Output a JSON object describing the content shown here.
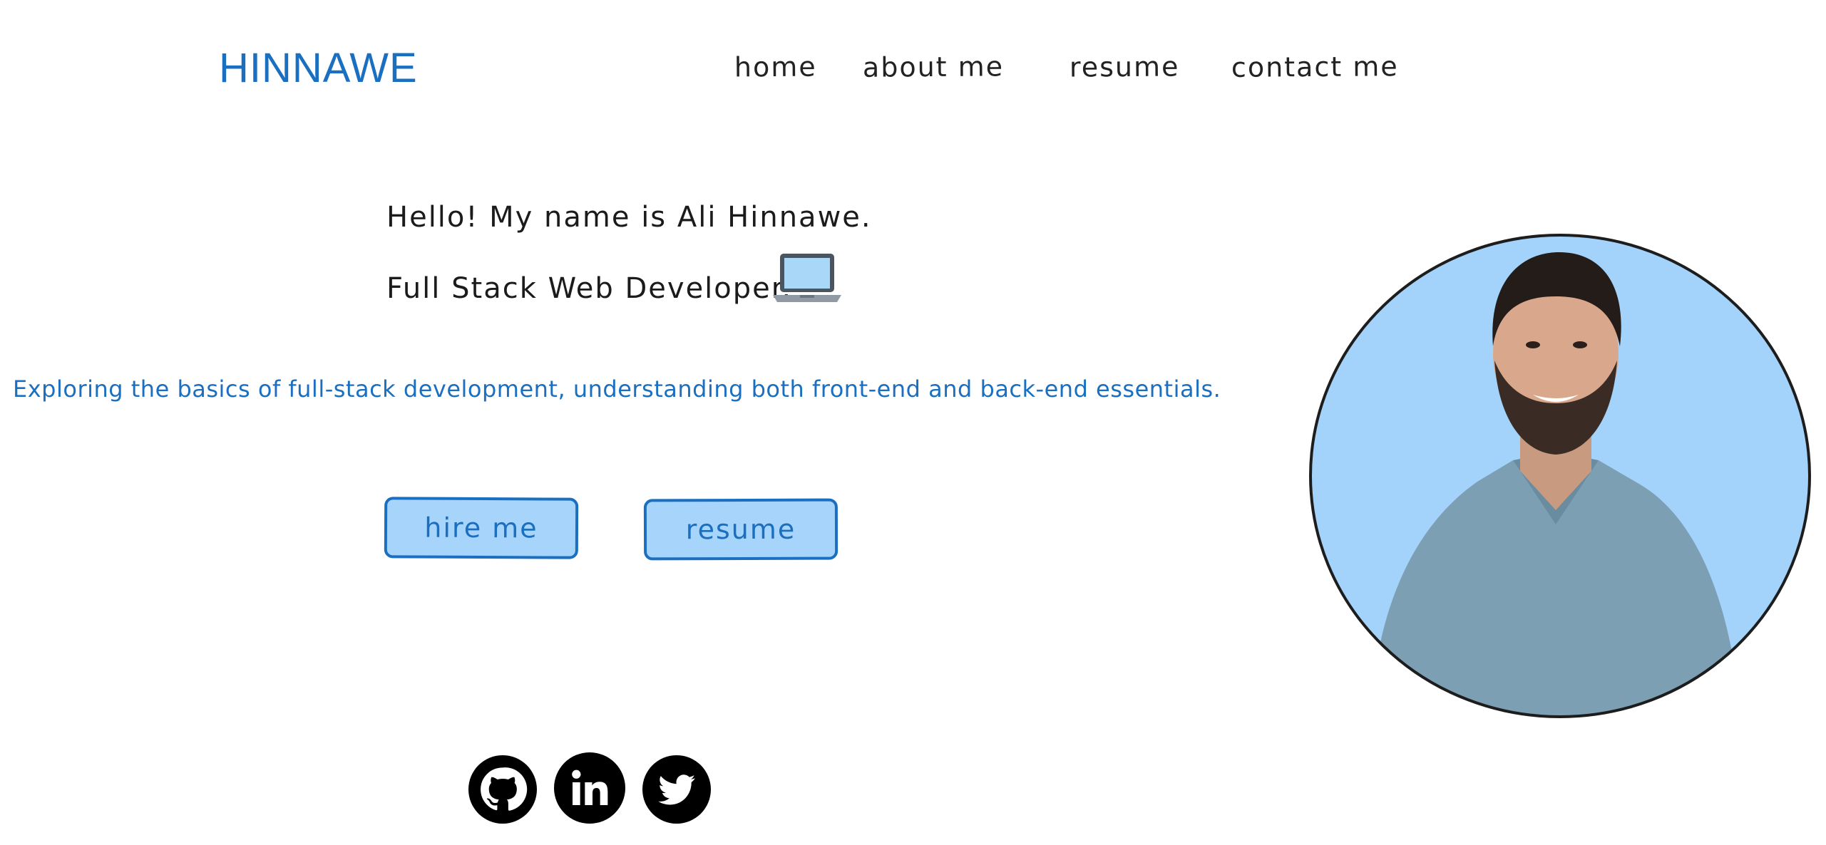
{
  "header": {
    "logo": "HINNAWE",
    "nav": {
      "home": "home",
      "about": "about me",
      "resume": "resume",
      "contact": "contact me"
    }
  },
  "hero": {
    "greeting": "Hello! My name is Ali Hinnawe.",
    "role": "Full Stack Web Developer.",
    "role_icon": "laptop-icon",
    "tagline": "Exploring the basics of full-stack development, understanding both front-end and back-end essentials.",
    "buttons": {
      "hire": "hire me",
      "resume": "resume"
    }
  },
  "socials": {
    "icons": [
      "github-icon",
      "linkedin-icon",
      "twitter-icon"
    ]
  },
  "portrait": {
    "image": "profile-photo"
  },
  "colors": {
    "accent": "#1a6fc0",
    "button_fill": "#a6d4fa",
    "portrait_bg": "#a3d3fa",
    "text": "#1b1b1b"
  }
}
